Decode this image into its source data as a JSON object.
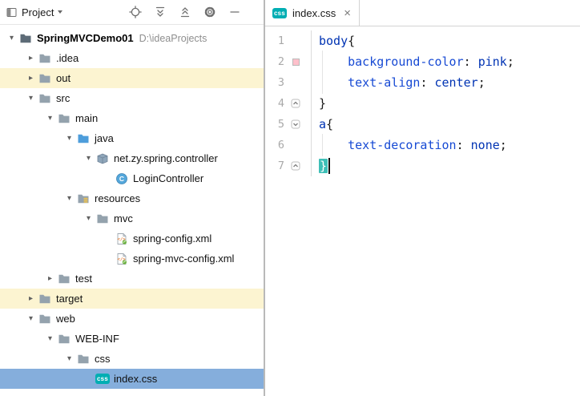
{
  "colors": {
    "selection_blue": "#85AEDC",
    "excluded_yellow": "#FCF4D1",
    "css_badge_teal": "#00AEB3",
    "brace_match_teal": "#3FBFB7"
  },
  "project_panel": {
    "toolbar": {
      "title": "Project",
      "icons": [
        {
          "name": "locate-icon"
        },
        {
          "name": "expand-all-icon"
        },
        {
          "name": "collapse-all-icon"
        },
        {
          "name": "settings-icon"
        },
        {
          "name": "hide-icon"
        }
      ]
    },
    "tree": [
      {
        "label": "SpringMVCDemo01",
        "path": "D:\\ideaProjects",
        "level": 0,
        "state": "expanded",
        "icon": "project-folder",
        "bold": true
      },
      {
        "label": ".idea",
        "level": 1,
        "state": "collapsed",
        "icon": "folder"
      },
      {
        "label": "out",
        "level": 1,
        "state": "collapsed",
        "icon": "folder",
        "highlighted": true
      },
      {
        "label": "src",
        "level": 1,
        "state": "expanded",
        "icon": "folder"
      },
      {
        "label": "main",
        "level": 2,
        "state": "expanded",
        "icon": "folder"
      },
      {
        "label": "java",
        "level": 3,
        "state": "expanded",
        "icon": "folder-source"
      },
      {
        "label": "net.zy.spring.controller",
        "level": 4,
        "state": "expanded",
        "icon": "package"
      },
      {
        "label": "LoginController",
        "level": 5,
        "state": "leaf",
        "icon": "class"
      },
      {
        "label": "resources",
        "level": 3,
        "state": "expanded",
        "icon": "folder-resources"
      },
      {
        "label": "mvc",
        "level": 4,
        "state": "expanded",
        "icon": "folder"
      },
      {
        "label": "spring-config.xml",
        "level": 5,
        "state": "leaf",
        "icon": "xml-file"
      },
      {
        "label": "spring-mvc-config.xml",
        "level": 5,
        "state": "leaf",
        "icon": "xml-file"
      },
      {
        "label": "test",
        "level": 2,
        "state": "collapsed",
        "icon": "folder"
      },
      {
        "label": "target",
        "level": 1,
        "state": "collapsed",
        "icon": "folder",
        "highlighted": true
      },
      {
        "label": "web",
        "level": 1,
        "state": "expanded",
        "icon": "folder"
      },
      {
        "label": "WEB-INF",
        "level": 2,
        "state": "expanded",
        "icon": "folder"
      },
      {
        "label": "css",
        "level": 3,
        "state": "expanded",
        "icon": "folder"
      },
      {
        "label": "index.css",
        "level": 4,
        "state": "leaf",
        "icon": "css-file",
        "selected": true
      }
    ]
  },
  "editor": {
    "tab": {
      "label": "index.css",
      "icon_label": "css",
      "close_label": "×"
    },
    "code": {
      "lines": [
        {
          "num": "1",
          "tokens": [
            [
              "selector",
              "body"
            ],
            [
              "punct",
              "{"
            ]
          ]
        },
        {
          "num": "2",
          "swatch": "#FFC0CB",
          "guide": true,
          "tokens": [
            [
              "ws",
              "    "
            ],
            [
              "property",
              "background-color"
            ],
            [
              "punct",
              ":"
            ],
            [
              "ws",
              " "
            ],
            [
              "value",
              "pink"
            ],
            [
              "punct",
              ";"
            ]
          ]
        },
        {
          "num": "3",
          "guide": true,
          "tokens": [
            [
              "ws",
              "    "
            ],
            [
              "property",
              "text-align"
            ],
            [
              "punct",
              ":"
            ],
            [
              "ws",
              " "
            ],
            [
              "value",
              "center"
            ],
            [
              "punct",
              ";"
            ]
          ]
        },
        {
          "num": "4",
          "fold": "end",
          "tokens": [
            [
              "punct",
              "}"
            ]
          ]
        },
        {
          "num": "5",
          "fold": "start",
          "tokens": [
            [
              "selector",
              "a"
            ],
            [
              "punct",
              "{"
            ]
          ]
        },
        {
          "num": "6",
          "guide": true,
          "tokens": [
            [
              "ws",
              "    "
            ],
            [
              "property",
              "text-decoration"
            ],
            [
              "punct",
              ":"
            ],
            [
              "ws",
              " "
            ],
            [
              "value",
              "none"
            ],
            [
              "punct",
              ";"
            ]
          ]
        },
        {
          "num": "7",
          "fold": "end",
          "brace_highlight": true,
          "caret": true,
          "tokens": [
            [
              "punct",
              "}"
            ]
          ]
        }
      ]
    }
  }
}
